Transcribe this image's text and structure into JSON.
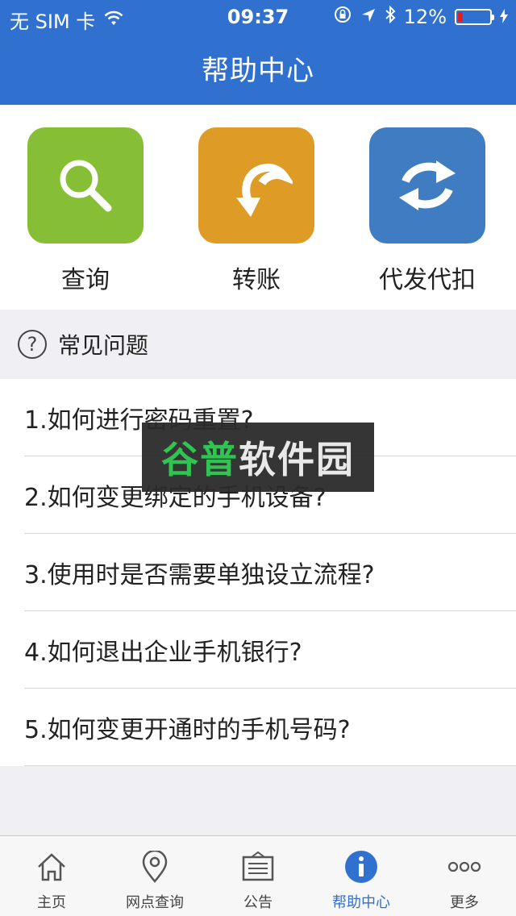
{
  "status_bar": {
    "carrier": "无 SIM 卡",
    "time": "09:37",
    "battery_percent": "12%"
  },
  "nav": {
    "title": "帮助中心"
  },
  "features": [
    {
      "label": "查询",
      "icon": "search-icon",
      "color": "#86bf35"
    },
    {
      "label": "转账",
      "icon": "transfer-arrow-icon",
      "color": "#de9b26"
    },
    {
      "label": "代发代扣",
      "icon": "exchange-icon",
      "color": "#3f7cc2"
    }
  ],
  "faq": {
    "title": "常见问题",
    "items": [
      "1.如何进行密码重置?",
      "2.如何变更绑定的手机设备?",
      "3.使用时是否需要单独设立流程?",
      "4.如何退出企业手机银行?",
      "5.如何变更开通时的手机号码?"
    ]
  },
  "watermark": {
    "part1": "谷普",
    "part2": "软件园"
  },
  "tabs": [
    {
      "label": "主页",
      "icon": "home-icon"
    },
    {
      "label": "网点查询",
      "icon": "location-pin-icon"
    },
    {
      "label": "公告",
      "icon": "notice-board-icon"
    },
    {
      "label": "帮助中心",
      "icon": "info-icon",
      "active": true
    },
    {
      "label": "更多",
      "icon": "more-dots-icon"
    }
  ],
  "colors": {
    "accent": "#3071d0",
    "background": "#efeff4"
  }
}
